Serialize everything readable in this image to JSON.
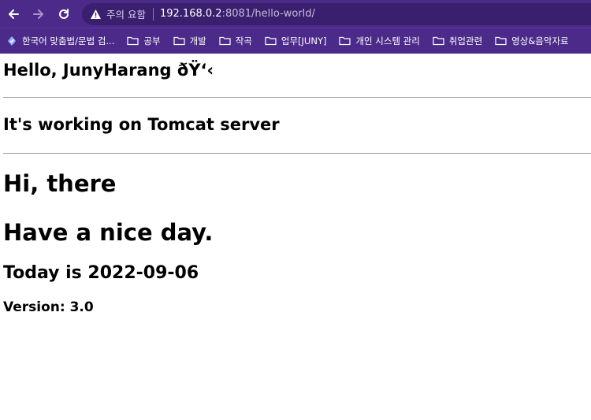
{
  "browser": {
    "security_label": "주의 요함",
    "url_host": "192.168.0.2",
    "url_rest": ":8081/hello-world/"
  },
  "bookmarks": [
    {
      "label": "한국어 맞춤법/문법 검...",
      "icon": "spellcheck-icon"
    },
    {
      "label": "공부",
      "icon": "folder-icon"
    },
    {
      "label": "개발",
      "icon": "folder-icon"
    },
    {
      "label": "작곡",
      "icon": "folder-icon"
    },
    {
      "label": "업무[JUNY]",
      "icon": "folder-icon"
    },
    {
      "label": "개인 시스템 관리",
      "icon": "folder-icon"
    },
    {
      "label": "취업관련",
      "icon": "folder-icon"
    },
    {
      "label": "영상&음악자료",
      "icon": "folder-icon"
    }
  ],
  "page": {
    "greeting": "Hello, JunyHarang ðŸ‘‹",
    "server_status": "It's working on Tomcat server",
    "hi": "Hi, there",
    "nice_day": "Have a nice day.",
    "today": "Today is 2022-09-06",
    "version": "Version: 3.0"
  },
  "colors": {
    "chrome_bg": "#4b2a8a",
    "omnibox_bg": "#3a1f6e",
    "divider": "#9a9a9a"
  }
}
